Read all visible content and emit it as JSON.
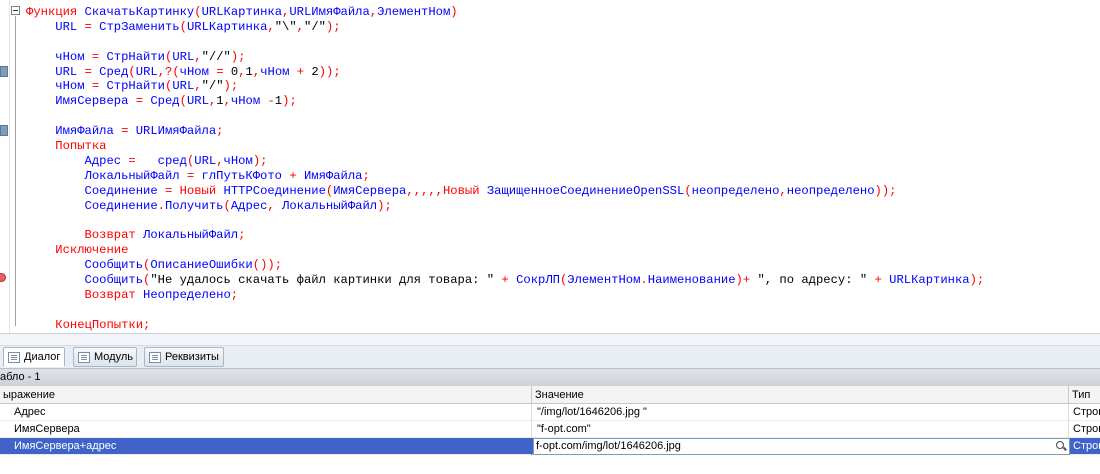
{
  "code": {
    "lines": [
      [
        [
          "kw",
          "Функция "
        ],
        [
          "id",
          "СкачатьКартинку"
        ],
        [
          "op",
          "("
        ],
        [
          "id",
          "URLКартинка"
        ],
        [
          "op",
          ","
        ],
        [
          "id",
          "URLИмяФайла"
        ],
        [
          "op",
          ","
        ],
        [
          "id",
          "ЭлементНом"
        ],
        [
          "op",
          ")"
        ]
      ],
      [
        [
          "id",
          "    URL "
        ],
        [
          "op",
          "= "
        ],
        [
          "id",
          "СтрЗаменить"
        ],
        [
          "op",
          "("
        ],
        [
          "id",
          "URLКартинка"
        ],
        [
          "op",
          ","
        ],
        [
          "str",
          "\"\\\""
        ],
        [
          "op",
          ","
        ],
        [
          "str",
          "\"/\""
        ],
        [
          "op",
          ");"
        ]
      ],
      [],
      [
        [
          "id",
          "    чНом "
        ],
        [
          "op",
          "= "
        ],
        [
          "id",
          "СтрНайти"
        ],
        [
          "op",
          "("
        ],
        [
          "id",
          "URL"
        ],
        [
          "op",
          ","
        ],
        [
          "str",
          "\"//\""
        ],
        [
          "op",
          ");"
        ]
      ],
      [
        [
          "id",
          "    URL "
        ],
        [
          "op",
          "= "
        ],
        [
          "id",
          "Сред"
        ],
        [
          "op",
          "("
        ],
        [
          "id",
          "URL"
        ],
        [
          "op",
          ",?("
        ],
        [
          "id",
          "чНом "
        ],
        [
          "op",
          "= "
        ],
        [
          "str",
          "0"
        ],
        [
          "op",
          ","
        ],
        [
          "str",
          "1"
        ],
        [
          "op",
          ","
        ],
        [
          "id",
          "чНом "
        ],
        [
          "op",
          "+ "
        ],
        [
          "str",
          "2"
        ],
        [
          "op",
          "));"
        ]
      ],
      [
        [
          "id",
          "    чНом "
        ],
        [
          "op",
          "= "
        ],
        [
          "id",
          "СтрНайти"
        ],
        [
          "op",
          "("
        ],
        [
          "id",
          "URL"
        ],
        [
          "op",
          ","
        ],
        [
          "str",
          "\"/\""
        ],
        [
          "op",
          ");"
        ]
      ],
      [
        [
          "id",
          "    ИмяСервера "
        ],
        [
          "op",
          "= "
        ],
        [
          "id",
          "Сред"
        ],
        [
          "op",
          "("
        ],
        [
          "id",
          "URL"
        ],
        [
          "op",
          ","
        ],
        [
          "str",
          "1"
        ],
        [
          "op",
          ","
        ],
        [
          "id",
          "чНом "
        ],
        [
          "op",
          "-"
        ],
        [
          "str",
          "1"
        ],
        [
          "op",
          ");"
        ]
      ],
      [],
      [
        [
          "id",
          "    ИмяФайла "
        ],
        [
          "op",
          "= "
        ],
        [
          "id",
          "URLИмяФайла"
        ],
        [
          "op",
          ";"
        ]
      ],
      [
        [
          "kw",
          "    Попытка"
        ]
      ],
      [
        [
          "id",
          "        Адрес "
        ],
        [
          "op",
          "=   "
        ],
        [
          "id",
          "сред"
        ],
        [
          "op",
          "("
        ],
        [
          "id",
          "URL"
        ],
        [
          "op",
          ","
        ],
        [
          "id",
          "чНом"
        ],
        [
          "op",
          ");"
        ]
      ],
      [
        [
          "id",
          "        ЛокальныйФайл "
        ],
        [
          "op",
          "= "
        ],
        [
          "id",
          "глПутьКФото "
        ],
        [
          "op",
          "+ "
        ],
        [
          "id",
          "ИмяФайла"
        ],
        [
          "op",
          ";"
        ]
      ],
      [
        [
          "id",
          "        Соединение "
        ],
        [
          "op",
          "= "
        ],
        [
          "kw",
          "Новый "
        ],
        [
          "id",
          "HTTPСоединение"
        ],
        [
          "op",
          "("
        ],
        [
          "id",
          "ИмяСервера"
        ],
        [
          "op",
          ",,,,,"
        ],
        [
          "kw",
          "Новый "
        ],
        [
          "id",
          "ЗащищенноеСоединениеOpenSSL"
        ],
        [
          "op",
          "("
        ],
        [
          "id",
          "неопределено"
        ],
        [
          "op",
          ","
        ],
        [
          "id",
          "неопределено"
        ],
        [
          "op",
          "));"
        ]
      ],
      [
        [
          "id",
          "        Соединение"
        ],
        [
          "op",
          "."
        ],
        [
          "id",
          "Получить"
        ],
        [
          "op",
          "("
        ],
        [
          "id",
          "Адрес"
        ],
        [
          "op",
          ", "
        ],
        [
          "id",
          "ЛокальныйФайл"
        ],
        [
          "op",
          ");"
        ]
      ],
      [],
      [
        [
          "kw",
          "        Возврат "
        ],
        [
          "id",
          "ЛокальныйФайл"
        ],
        [
          "op",
          ";"
        ]
      ],
      [
        [
          "kw",
          "    Исключение"
        ]
      ],
      [
        [
          "id",
          "        Сообщить"
        ],
        [
          "op",
          "("
        ],
        [
          "id",
          "ОписаниеОшибки"
        ],
        [
          "op",
          "());"
        ]
      ],
      [
        [
          "id",
          "        Сообщить"
        ],
        [
          "op",
          "("
        ],
        [
          "str",
          "\"Не удалось скачать файл картинки для товара: \" "
        ],
        [
          "op",
          "+ "
        ],
        [
          "id",
          "СокрЛП"
        ],
        [
          "op",
          "("
        ],
        [
          "id",
          "ЭлементНом"
        ],
        [
          "op",
          "."
        ],
        [
          "id",
          "Наименование"
        ],
        [
          "op",
          ")+ "
        ],
        [
          "str",
          "\", по адресу: \" "
        ],
        [
          "op",
          "+ "
        ],
        [
          "id",
          "URLКартинка"
        ],
        [
          "op",
          ");"
        ]
      ],
      [
        [
          "kw",
          "        Возврат "
        ],
        [
          "id",
          "Неопределено"
        ],
        [
          "op",
          ";"
        ]
      ],
      [],
      [
        [
          "kw",
          "    КонецПопытки"
        ],
        [
          "op",
          ";"
        ]
      ]
    ]
  },
  "tabs": [
    {
      "label": "Диалог",
      "active": true
    },
    {
      "label": "Модуль",
      "active": false
    },
    {
      "label": "Реквизиты",
      "active": false
    }
  ],
  "watch": {
    "title": "абло - 1",
    "headers": {
      "expr": "ыражение",
      "value": "Значение",
      "type": "Тип"
    },
    "rows": [
      {
        "expr": "Адрес",
        "value": "\"/img/lot/1646206.jpg \"",
        "type": "Строк"
      },
      {
        "expr": "ИмяСервера",
        "value": "\"f-opt.com\"",
        "type": "Строк"
      },
      {
        "expr": "ИмяСервера+адрес",
        "value": "f-opt.com/img/lot/1646206.jpg",
        "type": "Строк"
      }
    ]
  },
  "colors": {
    "keyword": "#ff0000",
    "identifier": "#0000ff",
    "selection": "#3f63c6"
  }
}
